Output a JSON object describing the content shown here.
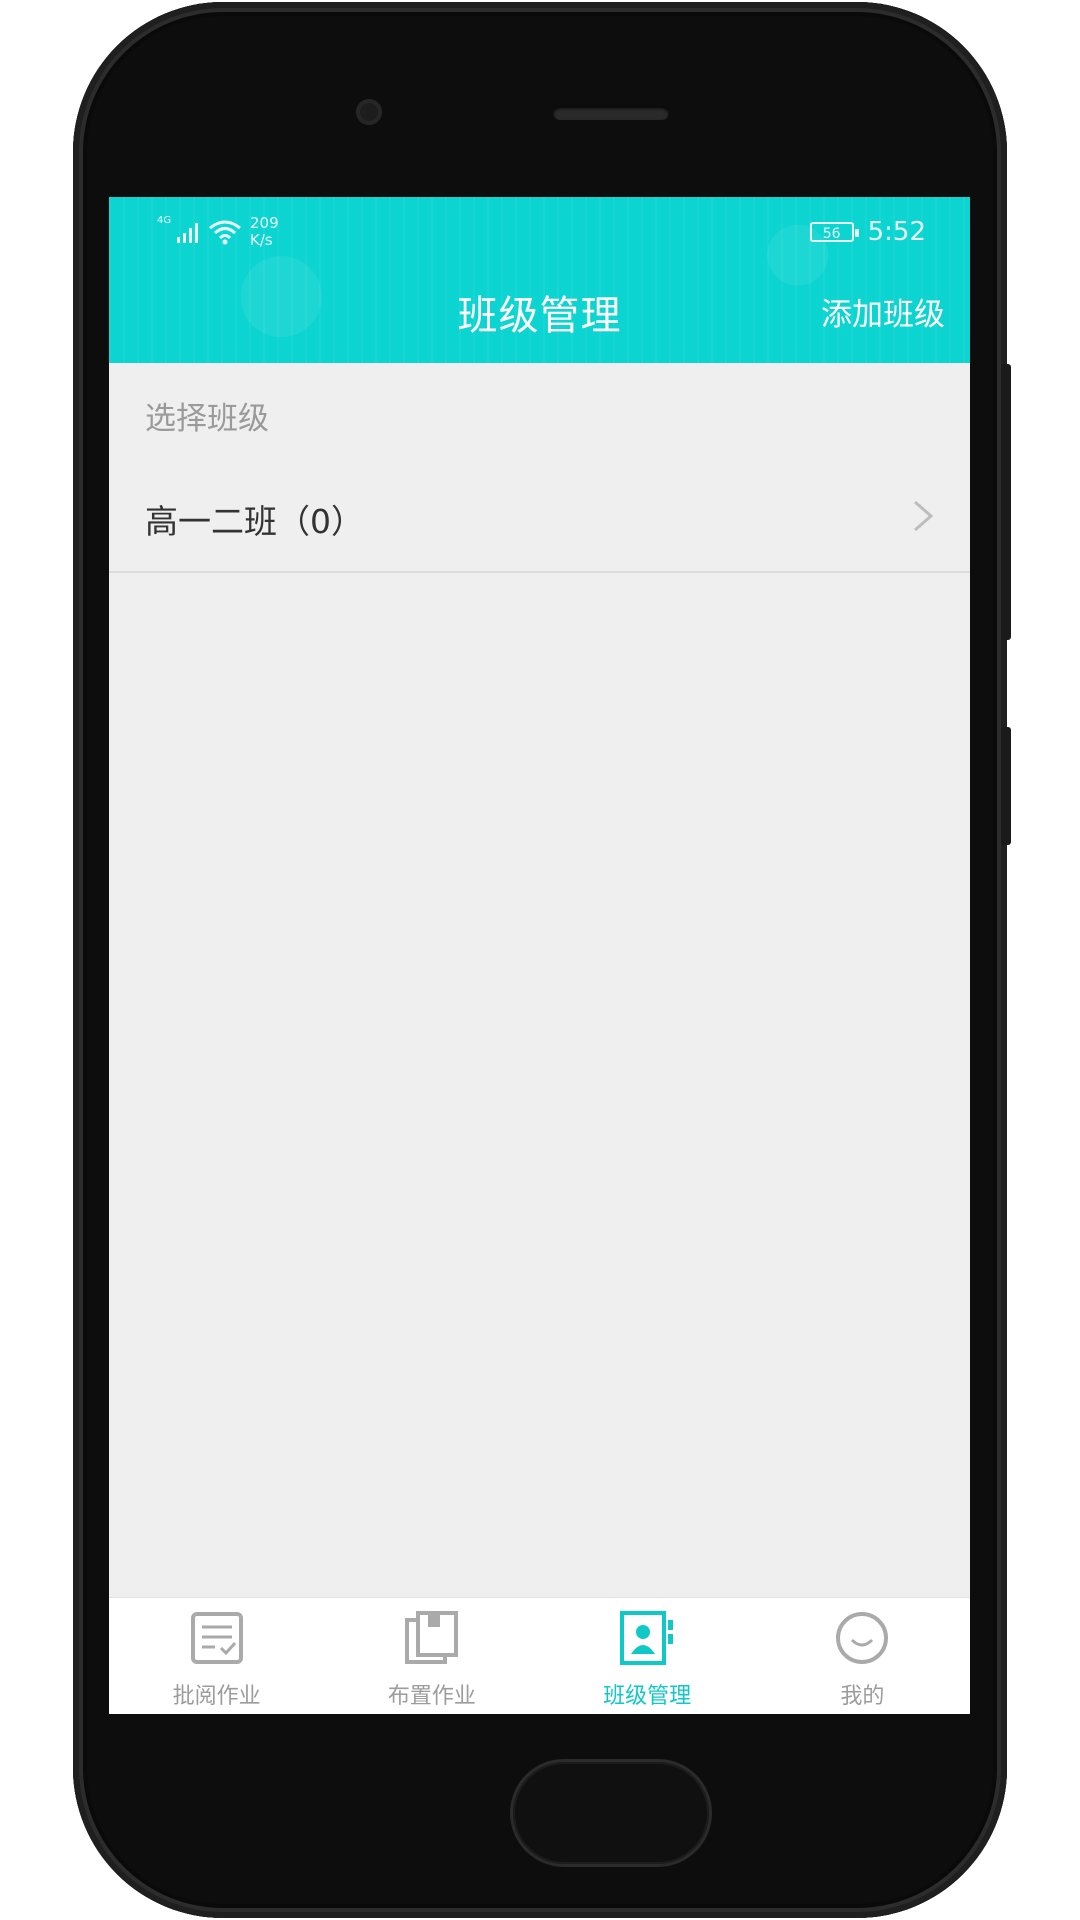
{
  "status_bar": {
    "network": "4G",
    "speed_value": "209",
    "speed_unit": "K/s",
    "battery": "56",
    "time": "5:52"
  },
  "header": {
    "title": "班级管理",
    "action": "添加班级"
  },
  "content": {
    "section_label": "选择班级",
    "classes": [
      {
        "name": "高一二班（0）"
      }
    ]
  },
  "bottom_nav": {
    "items": [
      {
        "label": "批阅作业",
        "icon": "review-homework-icon",
        "active": false
      },
      {
        "label": "布置作业",
        "icon": "assign-homework-icon",
        "active": false
      },
      {
        "label": "班级管理",
        "icon": "class-management-icon",
        "active": true
      },
      {
        "label": "我的",
        "icon": "smiley-icon",
        "active": false
      }
    ]
  },
  "colors": {
    "accent": "#0bd4d1",
    "active_tab": "#10c9c7",
    "inactive_tab": "#9c9c9c",
    "background": "#efefef"
  }
}
